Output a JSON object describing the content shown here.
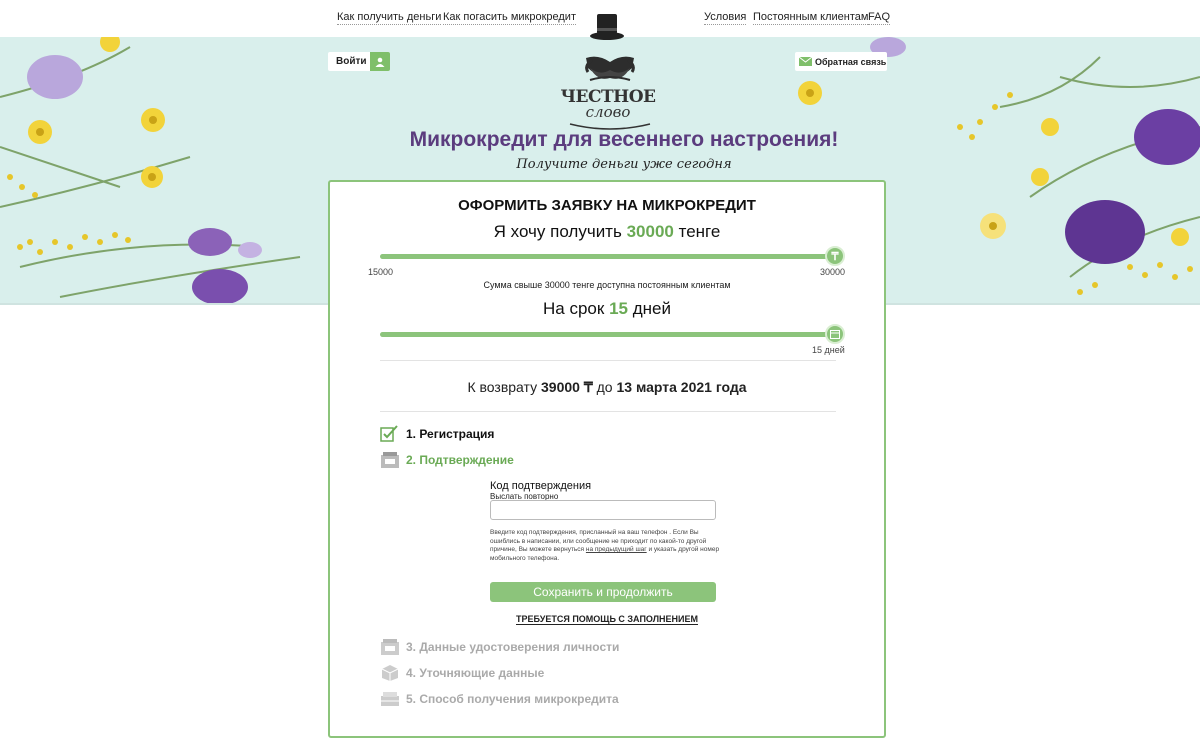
{
  "nav": {
    "left": [
      "Как получить деньги",
      "Как погасить микрокредит"
    ],
    "right": [
      "Условия",
      "Постоянным клиентам",
      "FAQ"
    ]
  },
  "logo": {
    "title": "ЧЕСТНОЕ",
    "subtitle": "слово"
  },
  "header": {
    "login_label": "Войти",
    "feedback_label": "Обратная связь",
    "headline": "Микрокредит для весеннего настроения!",
    "subline": "Получите деньги уже сегодня"
  },
  "form": {
    "title": "ОФОРМИТЬ ЗАЯВКУ НА МИКРОКРЕДИТ",
    "amount_prefix": "Я хочу получить",
    "amount_value": "30000",
    "amount_suffix": "тенге",
    "amount_min": "15000",
    "amount_max": "30000",
    "amount_level": 1.0,
    "amount_note": "Сумма свыше 30000 тенге доступна постоянным клиентам",
    "term_prefix": "На срок",
    "term_value": "15",
    "term_suffix": "дней",
    "term_tick": "15 дней",
    "term_level": 1.0,
    "return_prefix": "К возврату",
    "return_amount": "39000 ₸",
    "return_mid": "до",
    "return_date": "13 марта 2021 года"
  },
  "steps": [
    {
      "label": "1. Регистрация",
      "state": "done",
      "icon": "pen-check-icon"
    },
    {
      "label": "2. Подтверждение",
      "state": "active",
      "icon": "confirm-icon"
    },
    {
      "label": "3. Данные удостоверения личности",
      "state": "pending",
      "icon": "id-card-icon"
    },
    {
      "label": "4. Уточняющие данные",
      "state": "pending",
      "icon": "box-icon"
    },
    {
      "label": "5. Способ получения микрокредита",
      "state": "pending",
      "icon": "wallet-icon"
    }
  ],
  "confirm": {
    "code_label": "Код подтверждения",
    "resend_label": "Выслать повторно",
    "code_value": "",
    "help_text_1": "Введите код подтверждения, присланный на ваш телефон . Если Вы ошиблись в написании, или сообщение не приходит по какой-то другой причине, Вы можете вернуться",
    "help_link": "на предыдущий шаг",
    "help_text_2": "и указать другой номер мобильного телефона.",
    "save_label": "Сохранить и продолжить",
    "help_fill": "ТРЕБУЕТСЯ ПОМОЩЬ С ЗАПОЛНЕНИЕМ"
  },
  "colors": {
    "accent": "#8cc47b",
    "brand_purple": "#5b3c7e",
    "banner_bg": "#d9efec"
  }
}
